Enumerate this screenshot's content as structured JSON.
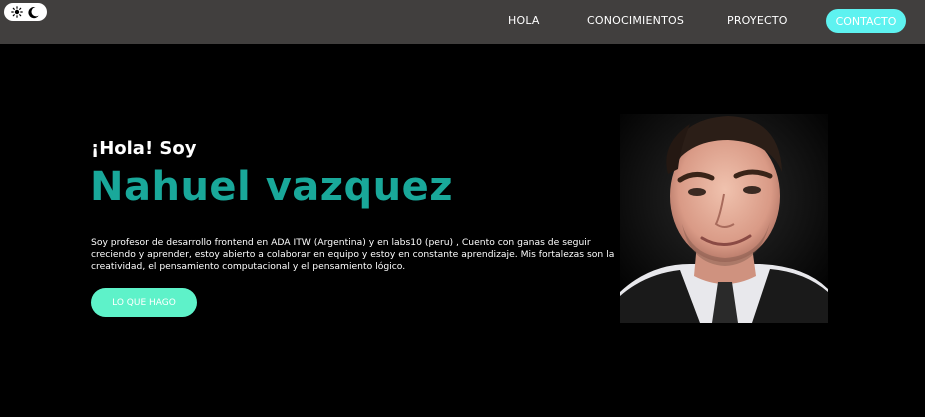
{
  "theme_toggle": {
    "sun_icon": "sun-icon",
    "moon_icon": "moon-icon"
  },
  "nav": {
    "hola": "HOLA",
    "conocimientos": "CONOCIMIENTOS",
    "proyecto": "PROYECTO",
    "contacto": "CONTACTO"
  },
  "hero": {
    "greeting": "¡Hola! Soy",
    "name": "Nahuel vazquez",
    "description": "Soy profesor de desarrollo frontend en ADA ITW (Argentina) y en labs10 (peru) , Cuento con ganas de seguir creciendo y aprender, estoy abierto a colaborar en equipo y estoy en constante aprendizaje. Mis fortalezas son la creatividad, el pensamiento computacional y el pensamiento lógico.",
    "button": "LO QUE HAGO"
  },
  "colors": {
    "accent_name": "#19a89a",
    "contact_button": "#5ef2f0",
    "cta_button": "#5ef2c9",
    "topbar": "#413f3e",
    "background": "#000000"
  }
}
